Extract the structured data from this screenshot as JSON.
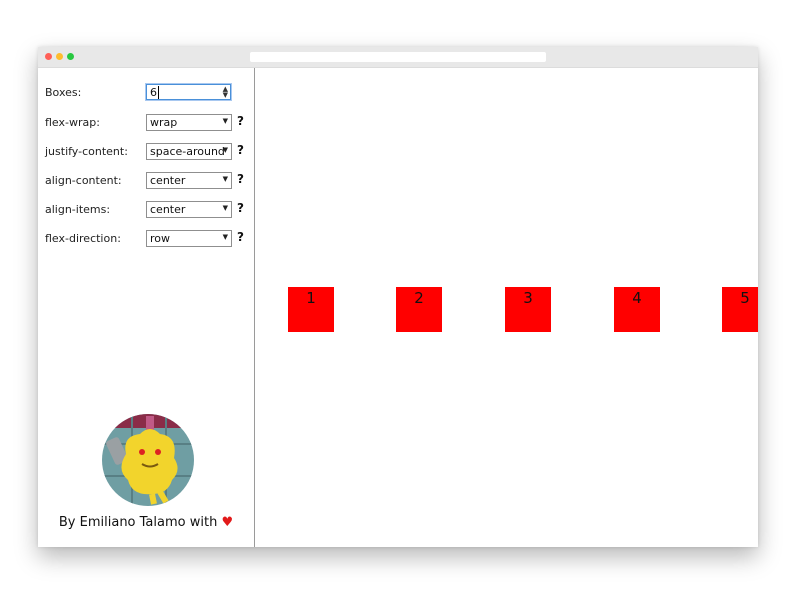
{
  "controls": {
    "boxes": {
      "label": "Boxes:",
      "value": "6"
    },
    "flex_wrap": {
      "label": "flex-wrap:",
      "value": "wrap",
      "help": "?"
    },
    "justify_content": {
      "label": "justify-content:",
      "value": "space-around",
      "help": "?"
    },
    "align_content": {
      "label": "align-content:",
      "value": "center",
      "help": "?"
    },
    "align_items": {
      "label": "align-items:",
      "value": "center",
      "help": "?"
    },
    "flex_direction": {
      "label": "flex-direction:",
      "value": "row",
      "help": "?"
    }
  },
  "credit": {
    "text": "By Emiliano Talamo with",
    "heart": "♥"
  },
  "boxes": [
    "1",
    "2",
    "3",
    "4",
    "5"
  ],
  "colors": {
    "box": "#ff0000",
    "heart": "#e21a1a",
    "traffic_red": "#ff5f57",
    "traffic_yellow": "#febc2e",
    "traffic_green": "#28c840"
  },
  "icons": {
    "window_close": "red-dot-icon",
    "window_minimize": "yellow-dot-icon",
    "window_maximize": "green-dot-icon",
    "select_arrow": "triangle-down-icon",
    "spinner": "up-down-arrows-icon"
  }
}
